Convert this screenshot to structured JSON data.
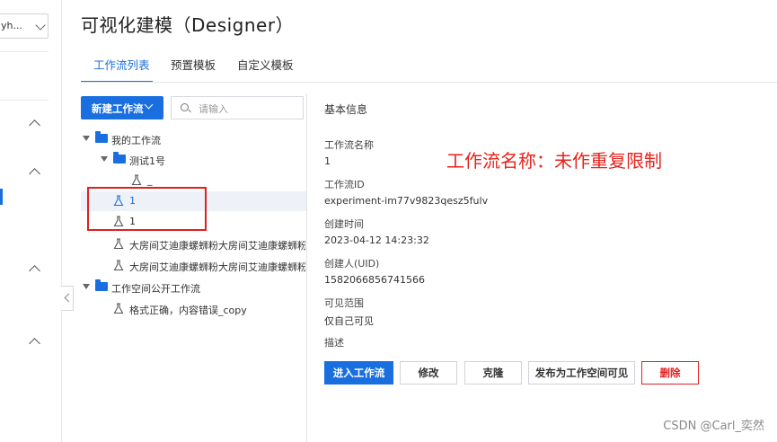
{
  "sidebar": {
    "workspace_select": "yh..."
  },
  "header": {
    "title": "可视化建模（Designer）",
    "tabs": [
      {
        "label": "工作流列表"
      },
      {
        "label": "预置模板"
      },
      {
        "label": "自定义模板"
      }
    ]
  },
  "list": {
    "new_button": "新建工作流",
    "search_placeholder": "请输入",
    "tree": [
      {
        "label": "我的工作流"
      },
      {
        "label": "测试1号"
      },
      {
        "label": "_"
      },
      {
        "label": "1"
      },
      {
        "label": "1"
      },
      {
        "label": "大房间艾迪康螺蛳粉大房间艾迪康螺蛳粉大房间艾迪康螺蛳粉"
      },
      {
        "label": "大房间艾迪康螺蛳粉大房间艾迪康螺蛳粉大房间艾迪康螺蛳粉"
      },
      {
        "label": "工作空间公开工作流"
      },
      {
        "label": "格式正确，内容错误_copy"
      }
    ]
  },
  "info": {
    "section_title": "基本信息",
    "fields": [
      {
        "label": "工作流名称",
        "value": "1"
      },
      {
        "label": "工作流ID",
        "value": "experiment-im77v9823qesz5fulv"
      },
      {
        "label": "创建时间",
        "value": "2023-04-12 14:23:32"
      },
      {
        "label": "创建人(UID)",
        "value": "1582066856741566"
      },
      {
        "label": "可见范围",
        "value": "仅自己可见"
      },
      {
        "label": "描述",
        "value": ""
      }
    ],
    "annotation": "工作流名称：未作重复限制",
    "buttons": {
      "enter": "进入工作流",
      "edit": "修改",
      "clone": "克隆",
      "publish": "发布为工作空间可见",
      "delete": "删除"
    }
  },
  "watermark": "CSDN @Carl_奕然",
  "colors": {
    "accent": "#1a6fe0",
    "danger": "#e02020",
    "annotation": "#e8211a"
  }
}
